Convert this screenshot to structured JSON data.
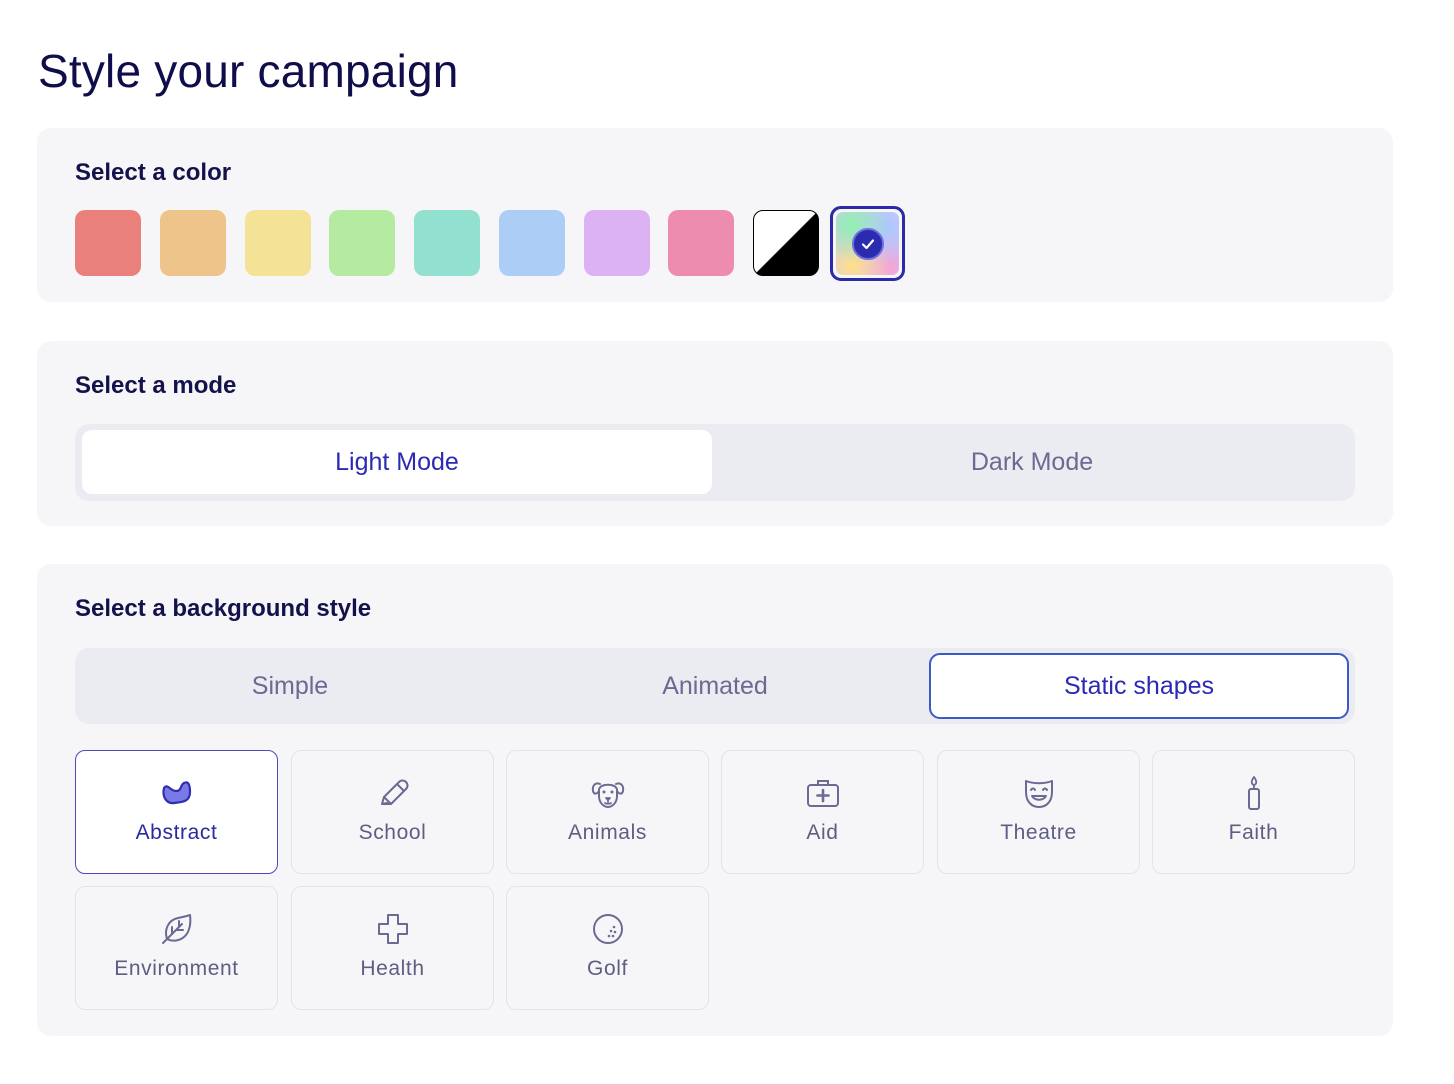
{
  "page": {
    "title": "Style your campaign"
  },
  "color_section": {
    "title": "Select a color",
    "swatches": [
      {
        "name": "red",
        "color": "#ea807b",
        "selected": false
      },
      {
        "name": "orange",
        "color": "#efc48a",
        "selected": false
      },
      {
        "name": "yellow",
        "color": "#f4e296",
        "selected": false
      },
      {
        "name": "green",
        "color": "#b5eaa1",
        "selected": false
      },
      {
        "name": "teal",
        "color": "#92e0cf",
        "selected": false
      },
      {
        "name": "blue",
        "color": "#abcdf6",
        "selected": false
      },
      {
        "name": "purple",
        "color": "#ddb2f5",
        "selected": false
      },
      {
        "name": "pink",
        "color": "#ed8cae",
        "selected": false
      },
      {
        "name": "black-white",
        "color": "#000000",
        "selected": false
      },
      {
        "name": "rainbow",
        "color": "gradient",
        "selected": true
      }
    ]
  },
  "mode_section": {
    "title": "Select a mode",
    "options": [
      {
        "label": "Light Mode",
        "selected": true
      },
      {
        "label": "Dark Mode",
        "selected": false
      }
    ]
  },
  "background_section": {
    "title": "Select a background style",
    "tabs": [
      {
        "label": "Simple",
        "selected": false
      },
      {
        "label": "Animated",
        "selected": false
      },
      {
        "label": "Static shapes",
        "selected": true
      }
    ],
    "shapes": [
      {
        "label": "Abstract",
        "icon": "abstract-blob-icon",
        "selected": true
      },
      {
        "label": "School",
        "icon": "pencil-icon",
        "selected": false
      },
      {
        "label": "Animals",
        "icon": "dog-icon",
        "selected": false
      },
      {
        "label": "Aid",
        "icon": "first-aid-kit-icon",
        "selected": false
      },
      {
        "label": "Theatre",
        "icon": "theatre-mask-icon",
        "selected": false
      },
      {
        "label": "Faith",
        "icon": "candle-icon",
        "selected": false
      },
      {
        "label": "Environment",
        "icon": "leaf-icon",
        "selected": false
      },
      {
        "label": "Health",
        "icon": "medical-cross-icon",
        "selected": false
      },
      {
        "label": "Golf",
        "icon": "golf-ball-icon",
        "selected": false
      }
    ]
  },
  "colors": {
    "accent": "#2b2bb0",
    "icon_stroke": "#6a6a93",
    "selected_icon": "#3a3ac0"
  }
}
